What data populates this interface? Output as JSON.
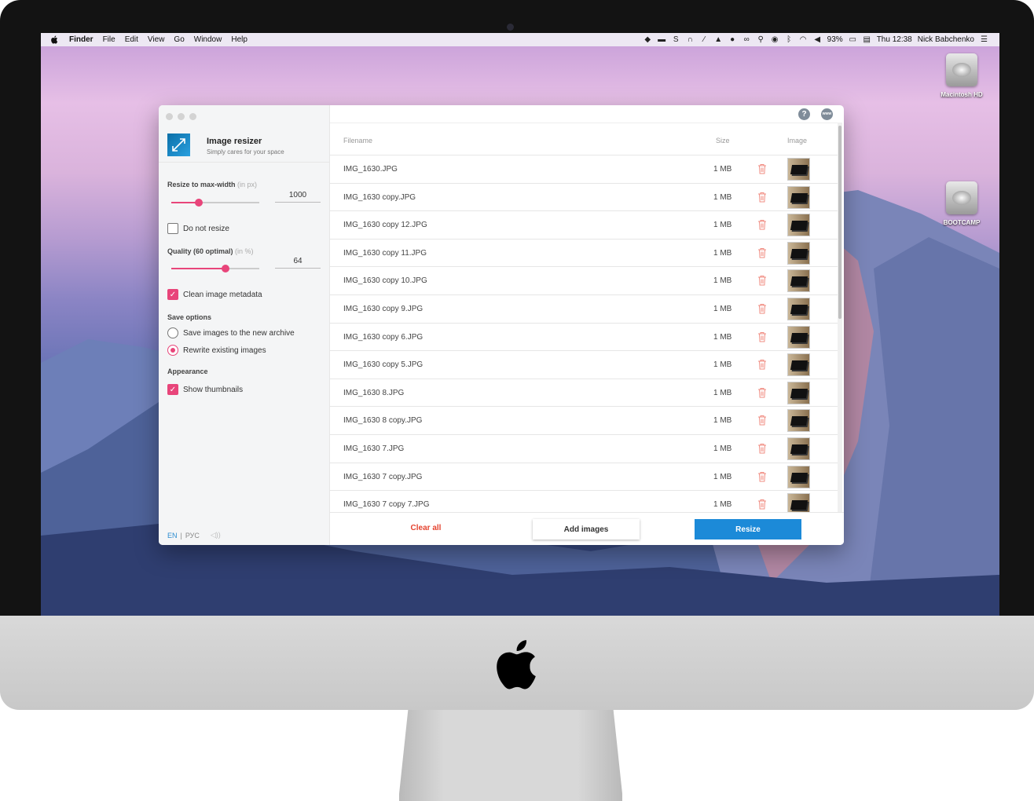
{
  "menubar": {
    "app_name": "Finder",
    "items": [
      "File",
      "Edit",
      "View",
      "Go",
      "Window",
      "Help"
    ],
    "battery": "93%",
    "clock": "Thu 12:38",
    "user": "Nick Babchenko"
  },
  "desktop": {
    "drives": [
      "Macintosh HD",
      "BOOTCAMP"
    ]
  },
  "app": {
    "title": "Image resizer",
    "subtitle": "Simply cares for your space",
    "help_icon": "?",
    "www_icon": "www"
  },
  "sidebar": {
    "resize_label": "Resize to max-width",
    "resize_hint": "(in px)",
    "resize_value": "1000",
    "resize_slider_fraction": 0.31,
    "do_not_resize": "Do not resize",
    "quality_label": "Quality (60 optimal)",
    "quality_hint": "(in %)",
    "quality_value": "64",
    "quality_slider_fraction": 0.62,
    "clean_metadata": "Clean image metadata",
    "save_options": "Save options",
    "save_new_archive": "Save images to the new archive",
    "rewrite_existing": "Rewrite existing images",
    "appearance": "Appearance",
    "show_thumbnails": "Show thumbnails",
    "lang_en": "EN",
    "lang_sep": "|",
    "lang_ru": "РУС"
  },
  "table": {
    "headers": {
      "filename": "Filename",
      "size": "Size",
      "image": "Image"
    },
    "rows": [
      {
        "filename": "IMG_1630.JPG",
        "size": "1 MB"
      },
      {
        "filename": "IMG_1630 copy.JPG",
        "size": "1 MB"
      },
      {
        "filename": "IMG_1630 copy 12.JPG",
        "size": "1 MB"
      },
      {
        "filename": "IMG_1630 copy 11.JPG",
        "size": "1 MB"
      },
      {
        "filename": "IMG_1630 copy 10.JPG",
        "size": "1 MB"
      },
      {
        "filename": "IMG_1630 copy 9.JPG",
        "size": "1 MB"
      },
      {
        "filename": "IMG_1630 copy 6.JPG",
        "size": "1 MB"
      },
      {
        "filename": "IMG_1630 copy 5.JPG",
        "size": "1 MB"
      },
      {
        "filename": "IMG_1630 8.JPG",
        "size": "1 MB"
      },
      {
        "filename": "IMG_1630 8 copy.JPG",
        "size": "1 MB"
      },
      {
        "filename": "IMG_1630 7.JPG",
        "size": "1 MB"
      },
      {
        "filename": "IMG_1630 7 copy.JPG",
        "size": "1 MB"
      },
      {
        "filename": "IMG_1630 7 copy 7.JPG",
        "size": "1 MB"
      }
    ]
  },
  "footer": {
    "clear_all": "Clear all",
    "add_images": "Add images",
    "resize": "Resize"
  },
  "colors": {
    "accent": "#e8457a",
    "primary": "#1c8ad8",
    "danger": "#e5432f"
  }
}
